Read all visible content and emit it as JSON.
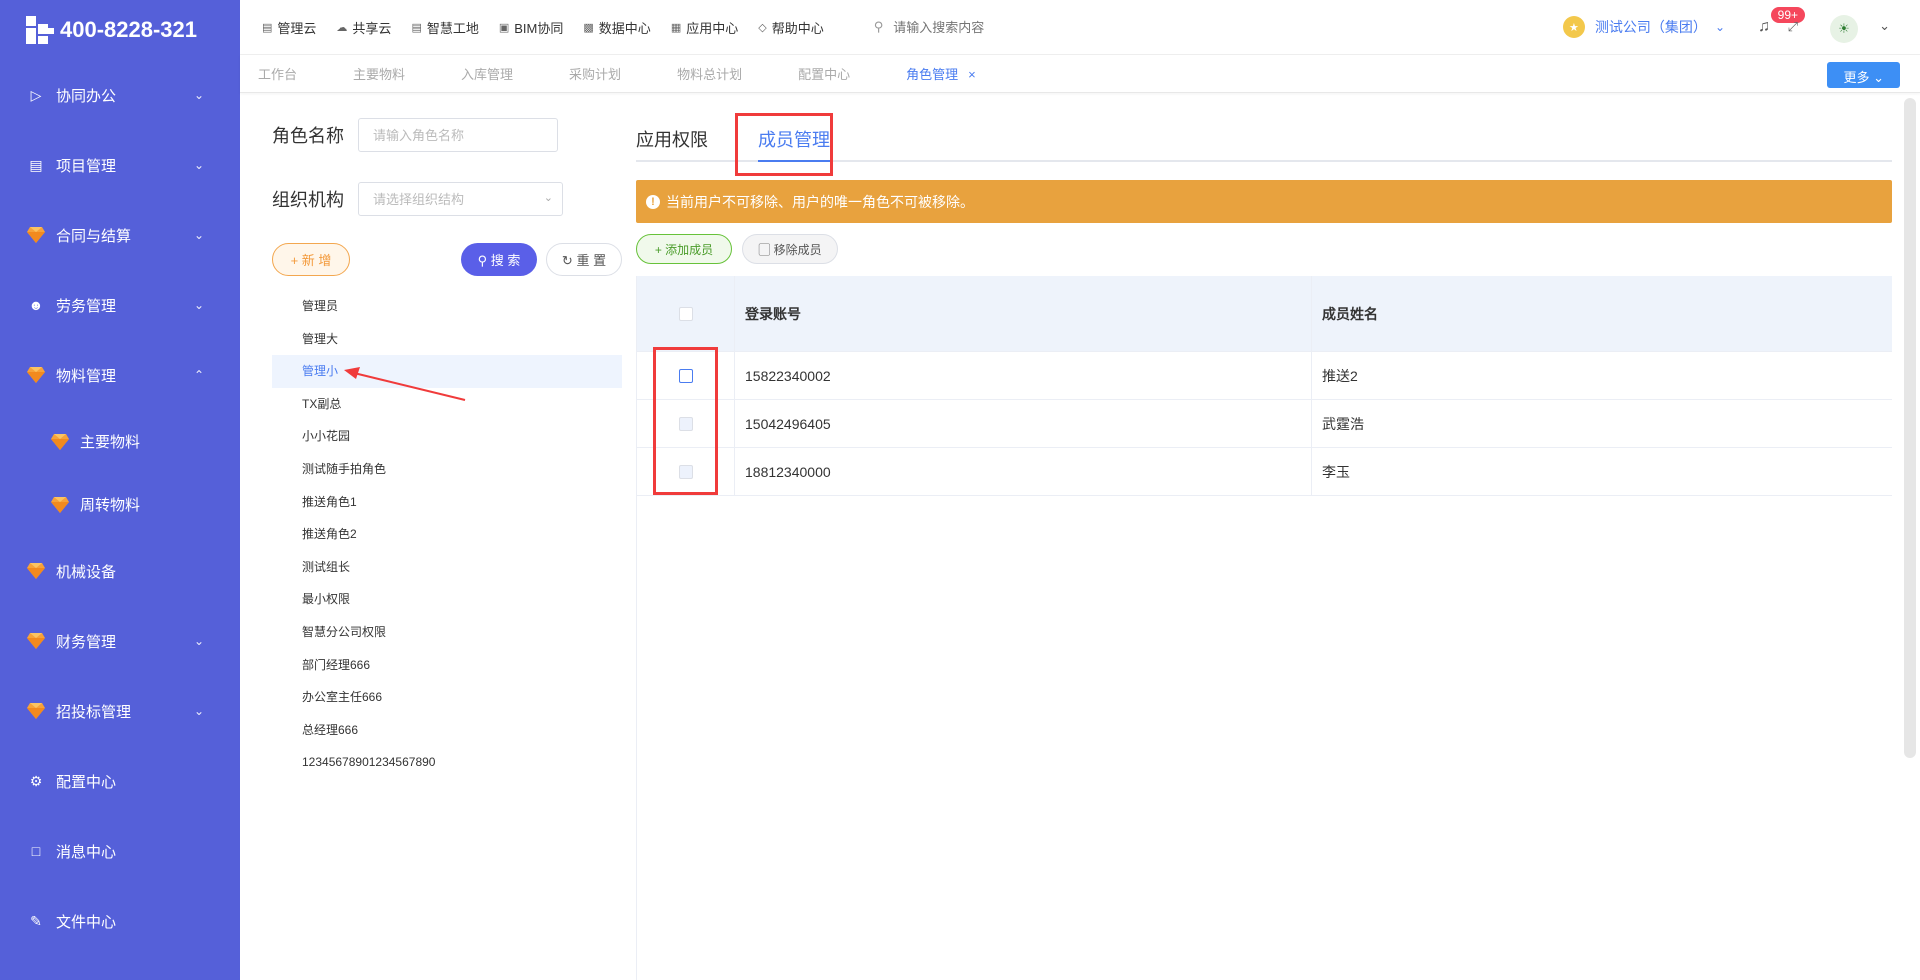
{
  "brand": {
    "phone": "400-8228-321"
  },
  "sidebar": {
    "items": [
      {
        "label": "协同办公",
        "icon": "send-icon",
        "chevron": "down"
      },
      {
        "label": "项目管理",
        "icon": "book-icon",
        "chevron": "down"
      },
      {
        "label": "合同与结算",
        "icon": "gem-icon",
        "chevron": "down"
      },
      {
        "label": "劳务管理",
        "icon": "worker-icon",
        "chevron": "down"
      },
      {
        "label": "物料管理",
        "icon": "gem-icon",
        "chevron": "up"
      },
      {
        "label": "主要物料",
        "icon": "gem-icon",
        "sub": true
      },
      {
        "label": "周转物料",
        "icon": "gem-icon",
        "sub": true
      },
      {
        "label": "机械设备",
        "icon": "gem-icon"
      },
      {
        "label": "财务管理",
        "icon": "gem-icon",
        "chevron": "down"
      },
      {
        "label": "招投标管理",
        "icon": "gem-icon",
        "chevron": "down"
      },
      {
        "label": "配置中心",
        "icon": "gear-icon"
      },
      {
        "label": "消息中心",
        "icon": "message-icon"
      },
      {
        "label": "文件中心",
        "icon": "file-icon"
      }
    ]
  },
  "topnav": {
    "items": [
      "管理云",
      "共享云",
      "智慧工地",
      "BIM协同",
      "数据中心",
      "应用中心",
      "帮助中心"
    ],
    "search_placeholder": "请输入搜索内容",
    "company": "测试公司（集团）",
    "badge": "99+"
  },
  "tabs": {
    "items": [
      "工作台",
      "主要物料",
      "入库管理",
      "采购计划",
      "物料总计划",
      "配置中心",
      "角色管理"
    ],
    "close": "×",
    "more": "更多"
  },
  "left": {
    "role_name_label": "角色名称",
    "role_name_placeholder": "请输入角色名称",
    "org_label": "组织机构",
    "org_placeholder": "请选择组织结构",
    "add_btn": "+ 新 增",
    "search_btn": "搜 索",
    "reset_btn": "重 置",
    "roles": [
      "管理员",
      "管理大",
      "管理小",
      "TX副总",
      "小小花园",
      "测试随手拍角色",
      "推送角色1",
      "推送角色2",
      "测试组长",
      "最小权限",
      "智慧分公司权限",
      "部门经理666",
      "办公室主任666",
      "总经理666",
      "12345678901234567890"
    ]
  },
  "right": {
    "tabs": [
      "应用权限",
      "成员管理"
    ],
    "alert": "当前用户不可移除、用户的唯一角色不可被移除。",
    "add_member": "+ 添加成员",
    "remove_member": "移除成员",
    "columns": [
      "登录账号",
      "成员姓名"
    ],
    "rows": [
      {
        "account": "15822340002",
        "name": "推送2"
      },
      {
        "account": "15042496405",
        "name": "武霆浩"
      },
      {
        "account": "18812340000",
        "name": "李玉"
      }
    ]
  },
  "colors": {
    "sidebar": "#5560d9",
    "accent": "#4a7cf0",
    "alert": "#e8a23e",
    "highlight": "#f03b3b"
  }
}
